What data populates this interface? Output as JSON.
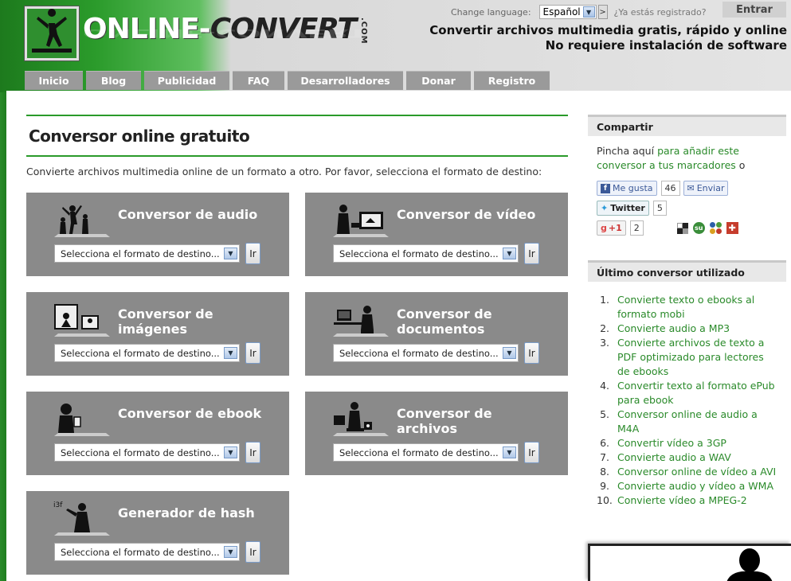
{
  "logo": {
    "text_light": "ONLINE-",
    "text_dark": "CONVERT",
    "suffix": ".COM"
  },
  "language": {
    "label": "Change language:",
    "selected": "Español",
    "go": ">"
  },
  "account": {
    "question": "¿Ya estás registrado?",
    "login_label": "Entrar"
  },
  "tagline": {
    "line1": "Convertir archivos multimedia gratis, rápido y online",
    "line2": "No requiere instalación de software"
  },
  "nav": [
    "Inicio",
    "Blog",
    "Publicidad",
    "FAQ",
    "Desarrolladores",
    "Donar",
    "Registro"
  ],
  "main": {
    "title": "Conversor online gratuito",
    "intro": "Convierte archivos multimedia online de un formato a otro. Por favor, selecciona el formato de destino:",
    "select_placeholder": "Selecciona el formato de destino...",
    "go_label": "Ir",
    "converters": [
      {
        "title": "Conversor de audio",
        "icon": "dancers-icon"
      },
      {
        "title": "Conversor de vídeo",
        "icon": "video-viewer-icon"
      },
      {
        "title": "Conversor de imágenes",
        "icon": "photo-frames-icon"
      },
      {
        "title": "Conversor de documentos",
        "icon": "office-worker-icon"
      },
      {
        "title": "Conversor de ebook",
        "icon": "ebook-reader-icon"
      },
      {
        "title": "Conversor de archivos",
        "icon": "archive-mover-icon"
      },
      {
        "title": "Generador de hash",
        "icon": "hash-writer-icon"
      }
    ]
  },
  "sidebar": {
    "share": {
      "heading": "Compartir",
      "text_prefix": "Pincha aquí",
      "text_link": "para añadir este conversor a tus marcadores",
      "text_suffix": "o",
      "facebook_like": "Me gusta",
      "facebook_count": "46",
      "send": "Enviar",
      "twitter": "Twitter",
      "twitter_count": "5",
      "gplus": "+1",
      "gplus_count": "2"
    },
    "recent": {
      "heading": "Último conversor utilizado",
      "items": [
        "Convierte texto o ebooks al formato mobi",
        "Convierte audio a MP3",
        "Convierte archivos de texto a PDF optimizado para lectores de ebooks",
        "Convertir texto al formato ePub para ebook",
        "Conversor online de audio a M4A",
        "Convertir vídeo a 3GP",
        "Convierte audio a WAV",
        "Conversor online de vídeo a AVI",
        "Convierte audio y vídeo a WMA",
        "Convierte vídeo a MPEG-2"
      ]
    }
  },
  "colors": {
    "accent_green": "#2a9a2a",
    "card_gray": "#8a8a8a",
    "link_green": "#2a8a2a"
  }
}
